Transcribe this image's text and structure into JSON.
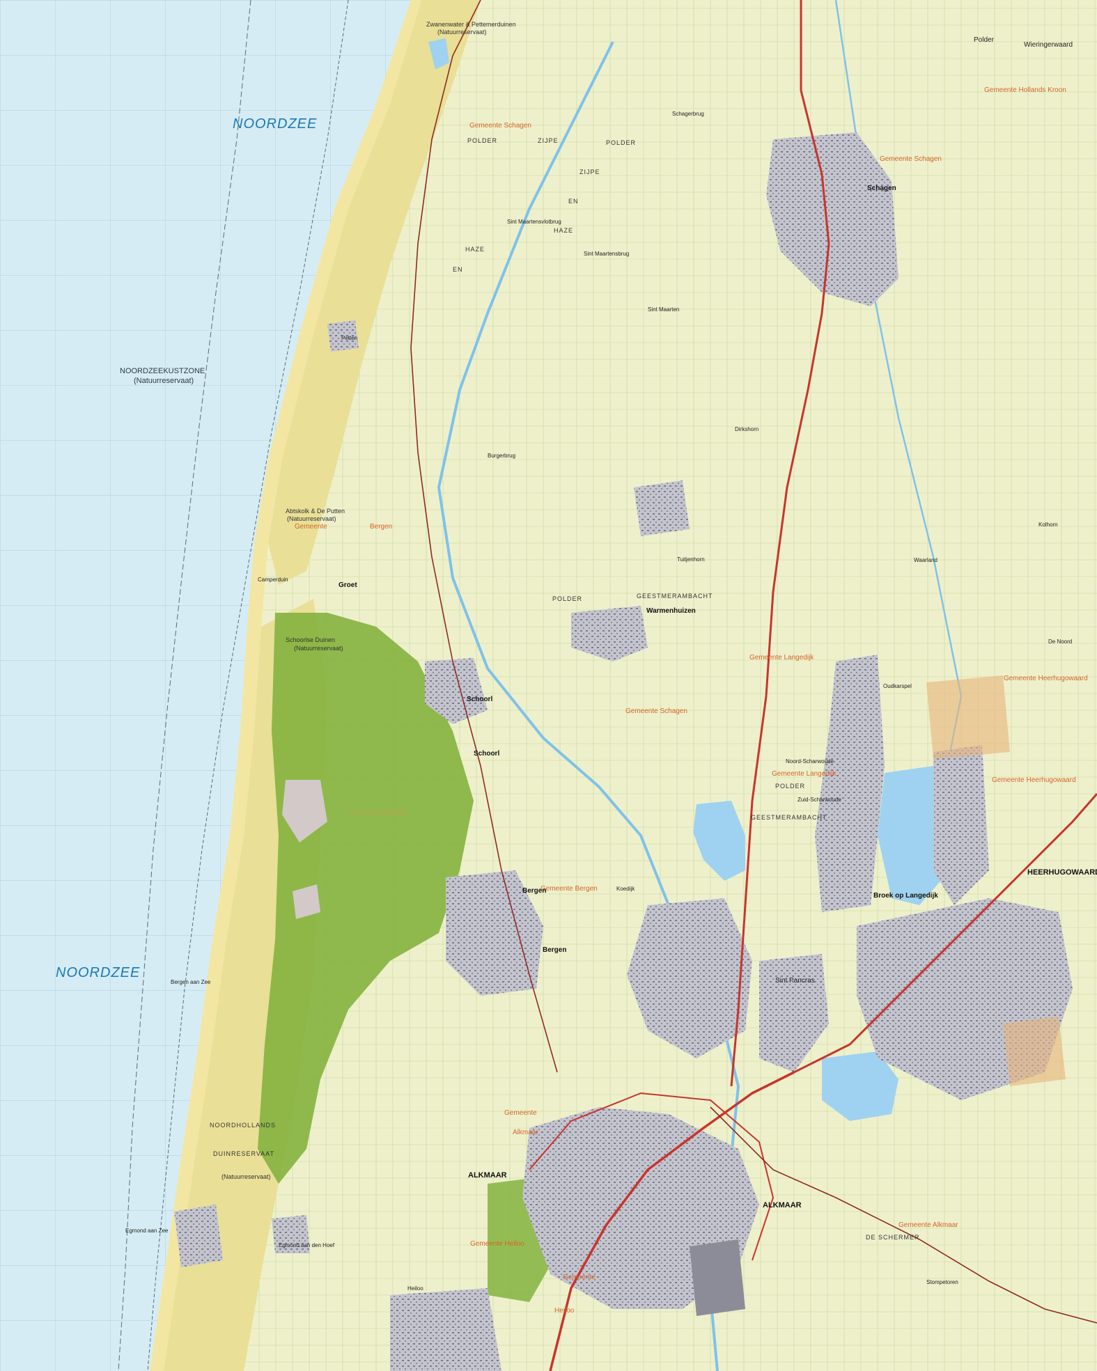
{
  "map": {
    "sea_labels": {
      "north": "NOORDZEE",
      "south": "NOORDZEE",
      "zone": "NOORDZEEKUSTZONE",
      "zone_note": "(Natuurreservaat)"
    },
    "places": {
      "alkmaar": "ALKMAAR",
      "alkmaar_east": "ALKMAAR",
      "heerhugowaard": "HEERHUGOWAARD",
      "schagen": "Schagen",
      "bergen": "Bergen",
      "bergen_south": "Bergen",
      "schoorl": "Schoorl",
      "schoorl_south": "Schoorl",
      "groet": "Groet",
      "camperduin": "Camperduin",
      "petten": "Petten",
      "sint_maartensvlotbrug": "Sint Maartensvlotbrug",
      "sint_maartensbrug": "Sint Maartensbrug",
      "sint_maarten": "Sint Maarten",
      "burgerbrug": "Burgerbrug",
      "schagerbrug": "Schagerbrug",
      "warmenhuizen": "Warmenhuizen",
      "tuitjenhorn": "Tuitjenhorn",
      "dirkshorn": "Dirkshorn",
      "oudkarspel": "Oudkarspel",
      "noord_scharwoude": "Noord-Scharwoude",
      "zuid_scharwoude": "Zuid-Scharwoude",
      "broek_op_langedijk": "Broek op Langedijk",
      "sint_pancras": "Sint Pancras",
      "koedijk": "Koedijk",
      "bergen_aan_zee": "Bergen aan Zee",
      "egmond_aan_zee": "Egmond aan Zee",
      "egmond_aan_den_hoef": "Egmond aan den Hoef",
      "heiloo": "Heiloo",
      "stompetoren": "Stompetoren",
      "de_noord": "De Noord",
      "waarland": "Waarland",
      "kolhorn": "Kolhorn"
    },
    "municipalities": {
      "schagen_nw": "Gemeente Schagen",
      "schagen_ne": "Gemeente Schagen",
      "schagen_mid": "Gemeente Schagen",
      "hollands_kroon": "Gemeente Hollands Kroon",
      "bergen_nw": "Gemeente",
      "bergen_nw2": "Bergen",
      "bergen_dunes": "Gemeente Bergen",
      "bergen_town": "Gemeente Bergen",
      "bergen_sw": "Gemeente",
      "alkmaar_w": "Alkmaar",
      "langedijk_n": "Gemeente Langedijk",
      "langedijk_s": "Gemeente Langedijk",
      "heerhugowaard_n": "Gemeente Heerhugowaard",
      "heerhugowaard_s": "Gemeente Heerhugowaard",
      "heiloo_muni": "Gemeente Heiloo",
      "heiloo_muni2": "Heiloo",
      "alkmaar_se": "Gemeente Alkmaar",
      "gemeente_s": "Gemeente"
    },
    "polders": {
      "zijpe_polder": "POLDER",
      "zijpe": "ZIJPE",
      "en1": "EN",
      "haze": "HAZE",
      "zijpe_polder2": "POLDER",
      "zijpe2": "ZIJPE",
      "en2": "EN",
      "haze2": "HAZE",
      "geest_polder": "POLDER",
      "geest": "GEESTMERAMBACHT",
      "geest_polder2": "POLDER",
      "geest2": "GEESTMERAMBACHT",
      "schermer": "DE SCHERMER",
      "wieringerwaard": "Wieringerwaard",
      "polder_top": "Polder"
    },
    "reserves": {
      "schoorlse_duinen": "Schoorlse Duinen",
      "schoorlse_note": "(Natuurreservaat)",
      "nhd1": "NOORDHOLLANDS",
      "nhd2": "DUINRESERVAAT",
      "nhd_note": "(Natuurreservaat)",
      "zwanenwater": "Zwanenwater & Pettemerduinen",
      "zwanenwater_note": "(Natuurreservaat)",
      "putten": "Abtskolk & De Putten",
      "putten_note": "(Natuurreservaat)"
    },
    "colors": {
      "sea": "#d6ecf4",
      "beach": "#f3e6a2",
      "dunes": "#e7dc8e",
      "forest": "#84b33e",
      "farmland": "#eef0cc",
      "water": "#9fd2f0",
      "urban": "#b9b9c4",
      "highway": "#c8342c",
      "municipal_label": "#d5652a",
      "sea_label": "#1a78b8"
    }
  }
}
